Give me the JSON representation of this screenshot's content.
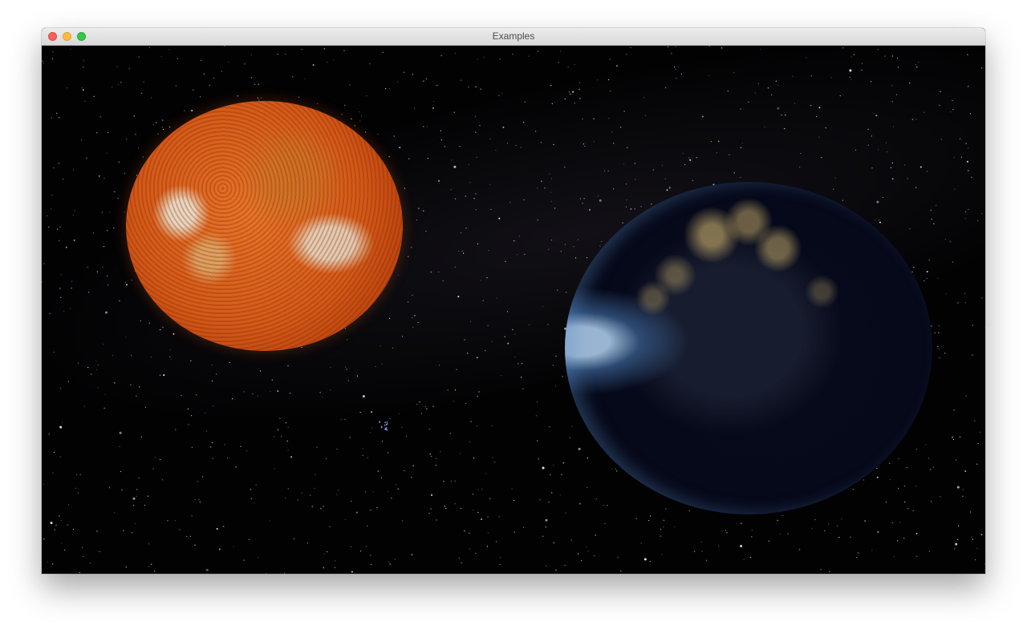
{
  "window": {
    "title": "Examples"
  },
  "scene": {
    "objects": [
      {
        "name": "sun",
        "texture": "solar-surface"
      },
      {
        "name": "earth",
        "texture": "earth-night-lights"
      }
    ],
    "background": "starfield"
  },
  "colors": {
    "close": "#fc605b",
    "minimize": "#fdbc40",
    "maximize": "#34c84a",
    "space": "#020203"
  }
}
